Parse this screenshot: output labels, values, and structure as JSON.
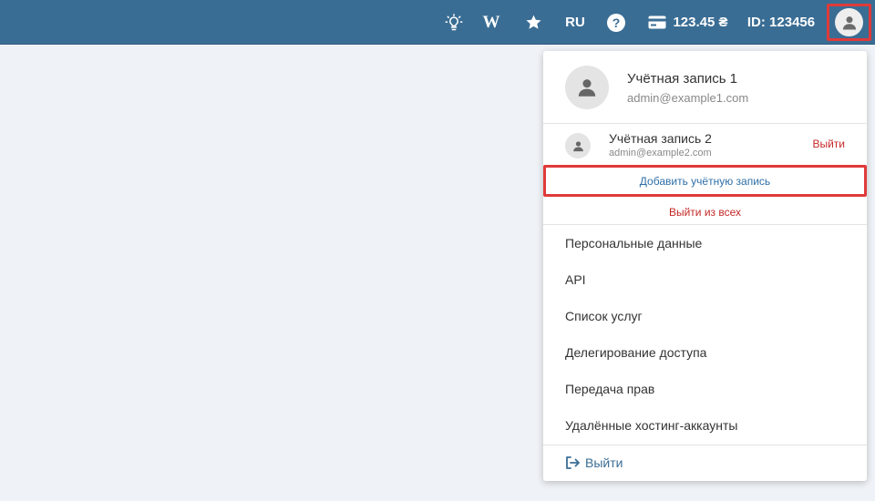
{
  "header": {
    "language": "RU",
    "balance": "123.45 ₴",
    "user_id": "ID: 123456",
    "wiki_label": "W",
    "help_label": "?",
    "icons": [
      "lightbulb-icon",
      "wiki-icon",
      "star-icon",
      "help-icon",
      "credit-card-icon",
      "user-avatar-icon"
    ],
    "bar_color": "#3a6d94"
  },
  "dropdown": {
    "current_account": {
      "name": "Учётная запись 1",
      "email": "admin@example1.com"
    },
    "other_account": {
      "name": "Учётная запись 2",
      "email": "admin@example2.com",
      "logout_label": "Выйти"
    },
    "add_account_label": "Добавить учётную запись",
    "logout_all_label": "Выйти из всех",
    "menu_items": [
      "Персональные данные",
      "API",
      "Список услуг",
      "Делегирование доступа",
      "Передача прав",
      "Удалённые хостинг-аккаунты"
    ],
    "logout_label": "Выйти"
  }
}
